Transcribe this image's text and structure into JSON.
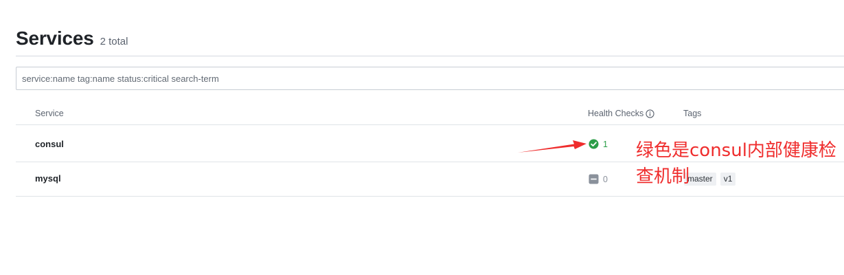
{
  "header": {
    "title": "Services",
    "count": "2 total"
  },
  "search": {
    "placeholder": "service:name tag:name status:critical search-term",
    "value": ""
  },
  "table": {
    "columns": {
      "service": "Service",
      "health": "Health Checks",
      "tags": "Tags"
    },
    "rows": [
      {
        "name": "consul",
        "health_status": "passing",
        "health_count": "1",
        "tags": []
      },
      {
        "name": "mysql",
        "health_status": "none",
        "health_count": "0",
        "tags": [
          "master",
          "v1"
        ]
      }
    ]
  },
  "annotation": {
    "text": "绿色是consul内部健康检查机制",
    "color": "#ef2d2d"
  },
  "colors": {
    "passing": "#2a9d47",
    "neutral": "#8a919b",
    "annotation": "#ef2d2d"
  },
  "icons": {
    "info": "info-circle-icon",
    "passing": "check-circle-icon",
    "none": "minus-square-icon"
  }
}
